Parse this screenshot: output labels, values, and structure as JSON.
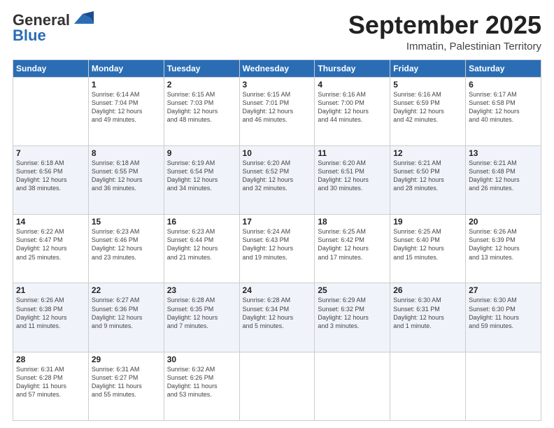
{
  "logo": {
    "line1": "General",
    "line2": "Blue"
  },
  "title": "September 2025",
  "subtitle": "Immatin, Palestinian Territory",
  "days_header": [
    "Sunday",
    "Monday",
    "Tuesday",
    "Wednesday",
    "Thursday",
    "Friday",
    "Saturday"
  ],
  "weeks": [
    [
      {
        "day": "",
        "text": ""
      },
      {
        "day": "1",
        "text": "Sunrise: 6:14 AM\nSunset: 7:04 PM\nDaylight: 12 hours\nand 49 minutes."
      },
      {
        "day": "2",
        "text": "Sunrise: 6:15 AM\nSunset: 7:03 PM\nDaylight: 12 hours\nand 48 minutes."
      },
      {
        "day": "3",
        "text": "Sunrise: 6:15 AM\nSunset: 7:01 PM\nDaylight: 12 hours\nand 46 minutes."
      },
      {
        "day": "4",
        "text": "Sunrise: 6:16 AM\nSunset: 7:00 PM\nDaylight: 12 hours\nand 44 minutes."
      },
      {
        "day": "5",
        "text": "Sunrise: 6:16 AM\nSunset: 6:59 PM\nDaylight: 12 hours\nand 42 minutes."
      },
      {
        "day": "6",
        "text": "Sunrise: 6:17 AM\nSunset: 6:58 PM\nDaylight: 12 hours\nand 40 minutes."
      }
    ],
    [
      {
        "day": "7",
        "text": "Sunrise: 6:18 AM\nSunset: 6:56 PM\nDaylight: 12 hours\nand 38 minutes."
      },
      {
        "day": "8",
        "text": "Sunrise: 6:18 AM\nSunset: 6:55 PM\nDaylight: 12 hours\nand 36 minutes."
      },
      {
        "day": "9",
        "text": "Sunrise: 6:19 AM\nSunset: 6:54 PM\nDaylight: 12 hours\nand 34 minutes."
      },
      {
        "day": "10",
        "text": "Sunrise: 6:20 AM\nSunset: 6:52 PM\nDaylight: 12 hours\nand 32 minutes."
      },
      {
        "day": "11",
        "text": "Sunrise: 6:20 AM\nSunset: 6:51 PM\nDaylight: 12 hours\nand 30 minutes."
      },
      {
        "day": "12",
        "text": "Sunrise: 6:21 AM\nSunset: 6:50 PM\nDaylight: 12 hours\nand 28 minutes."
      },
      {
        "day": "13",
        "text": "Sunrise: 6:21 AM\nSunset: 6:48 PM\nDaylight: 12 hours\nand 26 minutes."
      }
    ],
    [
      {
        "day": "14",
        "text": "Sunrise: 6:22 AM\nSunset: 6:47 PM\nDaylight: 12 hours\nand 25 minutes."
      },
      {
        "day": "15",
        "text": "Sunrise: 6:23 AM\nSunset: 6:46 PM\nDaylight: 12 hours\nand 23 minutes."
      },
      {
        "day": "16",
        "text": "Sunrise: 6:23 AM\nSunset: 6:44 PM\nDaylight: 12 hours\nand 21 minutes."
      },
      {
        "day": "17",
        "text": "Sunrise: 6:24 AM\nSunset: 6:43 PM\nDaylight: 12 hours\nand 19 minutes."
      },
      {
        "day": "18",
        "text": "Sunrise: 6:25 AM\nSunset: 6:42 PM\nDaylight: 12 hours\nand 17 minutes."
      },
      {
        "day": "19",
        "text": "Sunrise: 6:25 AM\nSunset: 6:40 PM\nDaylight: 12 hours\nand 15 minutes."
      },
      {
        "day": "20",
        "text": "Sunrise: 6:26 AM\nSunset: 6:39 PM\nDaylight: 12 hours\nand 13 minutes."
      }
    ],
    [
      {
        "day": "21",
        "text": "Sunrise: 6:26 AM\nSunset: 6:38 PM\nDaylight: 12 hours\nand 11 minutes."
      },
      {
        "day": "22",
        "text": "Sunrise: 6:27 AM\nSunset: 6:36 PM\nDaylight: 12 hours\nand 9 minutes."
      },
      {
        "day": "23",
        "text": "Sunrise: 6:28 AM\nSunset: 6:35 PM\nDaylight: 12 hours\nand 7 minutes."
      },
      {
        "day": "24",
        "text": "Sunrise: 6:28 AM\nSunset: 6:34 PM\nDaylight: 12 hours\nand 5 minutes."
      },
      {
        "day": "25",
        "text": "Sunrise: 6:29 AM\nSunset: 6:32 PM\nDaylight: 12 hours\nand 3 minutes."
      },
      {
        "day": "26",
        "text": "Sunrise: 6:30 AM\nSunset: 6:31 PM\nDaylight: 12 hours\nand 1 minute."
      },
      {
        "day": "27",
        "text": "Sunrise: 6:30 AM\nSunset: 6:30 PM\nDaylight: 11 hours\nand 59 minutes."
      }
    ],
    [
      {
        "day": "28",
        "text": "Sunrise: 6:31 AM\nSunset: 6:28 PM\nDaylight: 11 hours\nand 57 minutes."
      },
      {
        "day": "29",
        "text": "Sunrise: 6:31 AM\nSunset: 6:27 PM\nDaylight: 11 hours\nand 55 minutes."
      },
      {
        "day": "30",
        "text": "Sunrise: 6:32 AM\nSunset: 6:26 PM\nDaylight: 11 hours\nand 53 minutes."
      },
      {
        "day": "",
        "text": ""
      },
      {
        "day": "",
        "text": ""
      },
      {
        "day": "",
        "text": ""
      },
      {
        "day": "",
        "text": ""
      }
    ]
  ]
}
